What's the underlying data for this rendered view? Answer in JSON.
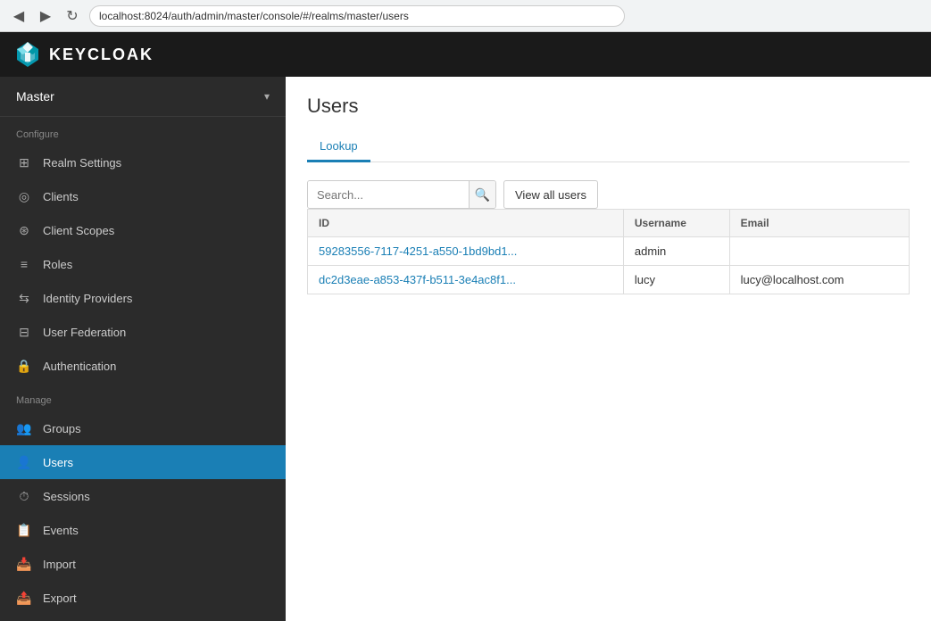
{
  "browser": {
    "back_btn": "◀",
    "forward_btn": "▶",
    "refresh_btn": "↻",
    "url": "localhost:8024/auth/admin/master/console/#/realms/master/users"
  },
  "topbar": {
    "logo_text": "KEYCLOAK"
  },
  "sidebar": {
    "realm": {
      "name": "Master",
      "chevron": "▾"
    },
    "configure_label": "Configure",
    "configure_items": [
      {
        "id": "realm-settings",
        "label": "Realm Settings",
        "icon": "grid"
      },
      {
        "id": "clients",
        "label": "Clients",
        "icon": "circle"
      },
      {
        "id": "client-scopes",
        "label": "Client Scopes",
        "icon": "scopes"
      },
      {
        "id": "roles",
        "label": "Roles",
        "icon": "list"
      },
      {
        "id": "identity-providers",
        "label": "Identity Providers",
        "icon": "identity"
      },
      {
        "id": "user-federation",
        "label": "User Federation",
        "icon": "federation"
      },
      {
        "id": "authentication",
        "label": "Authentication",
        "icon": "lock"
      }
    ],
    "manage_label": "Manage",
    "manage_items": [
      {
        "id": "groups",
        "label": "Groups",
        "icon": "people"
      },
      {
        "id": "users",
        "label": "Users",
        "icon": "person",
        "active": true
      },
      {
        "id": "sessions",
        "label": "Sessions",
        "icon": "clock"
      },
      {
        "id": "events",
        "label": "Events",
        "icon": "calendar"
      },
      {
        "id": "import",
        "label": "Import",
        "icon": "import"
      },
      {
        "id": "export",
        "label": "Export",
        "icon": "export"
      }
    ]
  },
  "content": {
    "page_title": "Users",
    "tabs": [
      {
        "id": "lookup",
        "label": "Lookup",
        "active": true
      }
    ],
    "search": {
      "placeholder": "Search...",
      "search_icon": "🔍",
      "view_all_btn": "View all users"
    },
    "table": {
      "columns": [
        "ID",
        "Username",
        "Email"
      ],
      "rows": [
        {
          "id": "59283556-7117-4251-a550-1bd9bd1...",
          "username": "admin",
          "email": ""
        },
        {
          "id": "dc2d3eae-a853-437f-b511-3e4ac8f1...",
          "username": "lucy",
          "email": "lucy@localhost.com"
        }
      ]
    }
  }
}
